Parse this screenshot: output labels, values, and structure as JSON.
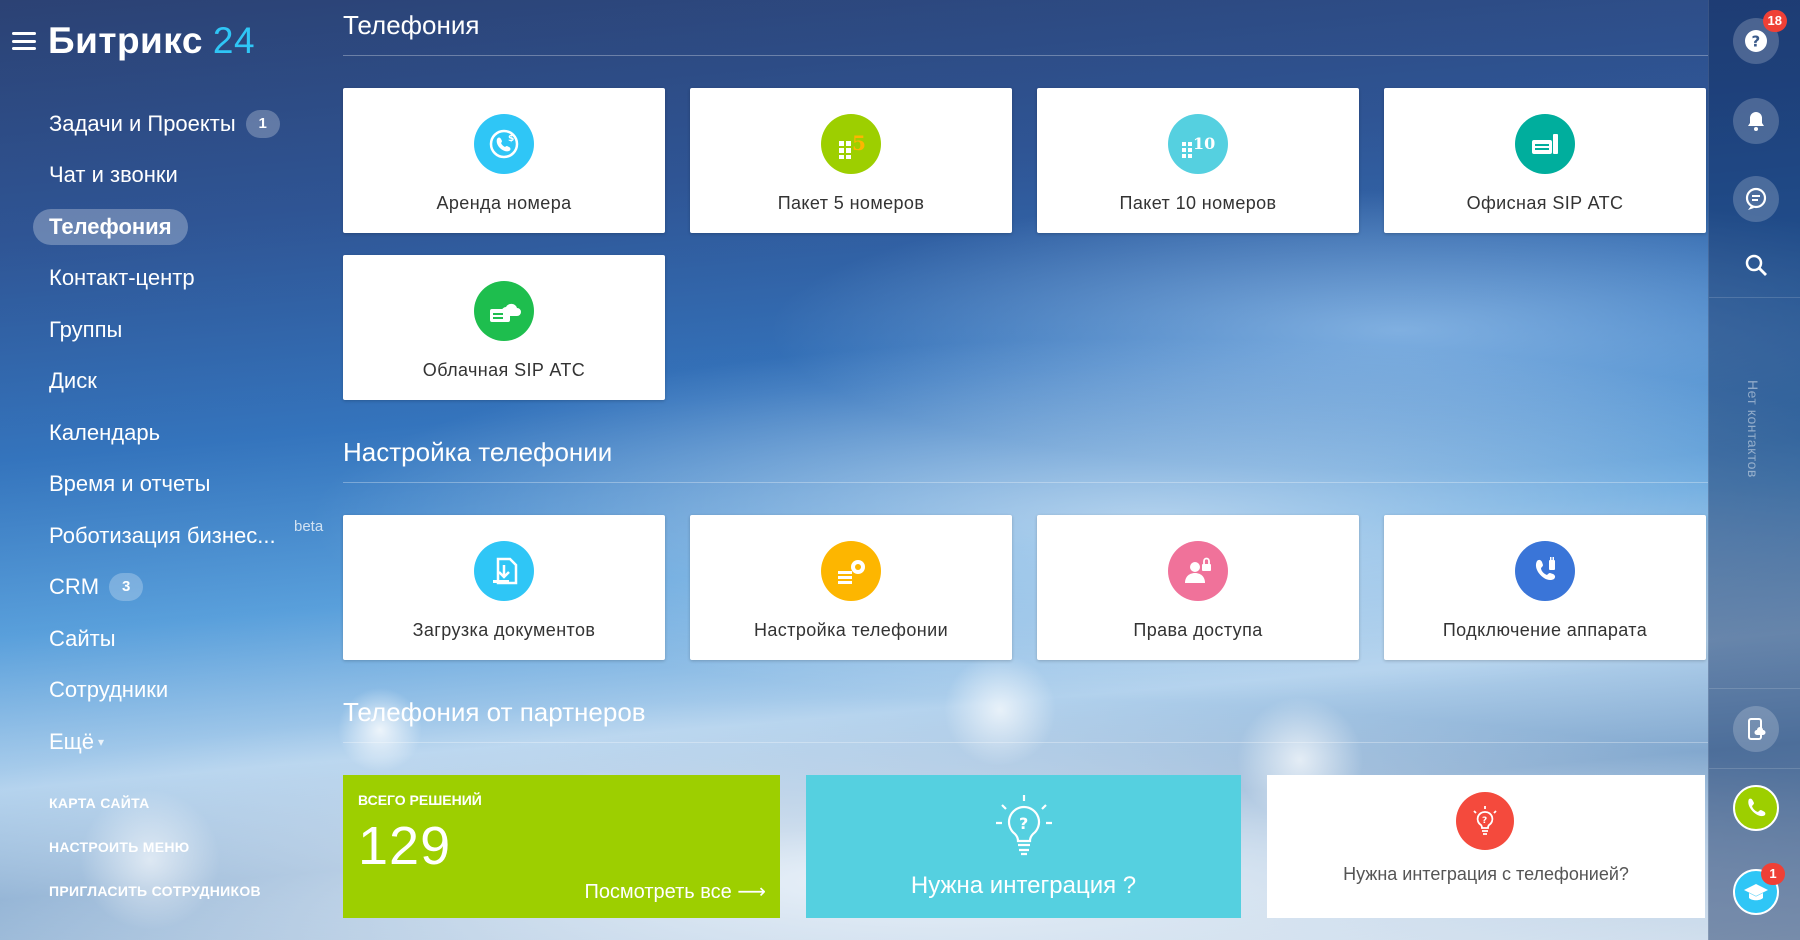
{
  "app": {
    "logo_main": "Битрикс",
    "logo_num": "24"
  },
  "sidebar": {
    "items": [
      {
        "label": "Задачи и Проекты",
        "counter": "1"
      },
      {
        "label": "Чат и звонки"
      },
      {
        "label": "Телефония",
        "active": true
      },
      {
        "label": "Контакт-центр"
      },
      {
        "label": "Группы"
      },
      {
        "label": "Диск"
      },
      {
        "label": "Календарь"
      },
      {
        "label": "Время и отчеты"
      },
      {
        "label": "Роботизация бизнес...",
        "tag": "beta"
      },
      {
        "label": "CRM",
        "counter": "3"
      },
      {
        "label": "Сайты"
      },
      {
        "label": "Сотрудники"
      },
      {
        "label": "Ещё"
      }
    ],
    "footer": [
      "КАРТА САЙТА",
      "НАСТРОИТЬ МЕНЮ",
      "ПРИГЛАСИТЬ СОТРУДНИКОВ"
    ]
  },
  "telephony": {
    "title": "Телефония",
    "tiles": [
      {
        "label": "Аренда номера",
        "icon": "rent-number-icon",
        "color": "#2fc6f6"
      },
      {
        "label": "Пакет 5 номеров",
        "icon": "package-5-icon",
        "color": "#9dcf00"
      },
      {
        "label": "Пакет 10 номеров",
        "icon": "package-10-icon",
        "color": "#55d0e0"
      },
      {
        "label": "Офисная SIP АТС",
        "icon": "office-sip-icon",
        "color": "#00ae9d"
      },
      {
        "label": "Облачная SIP АТС",
        "icon": "cloud-sip-icon",
        "color": "#1ebe4e"
      }
    ]
  },
  "setup": {
    "title": "Настройка телефонии",
    "tiles": [
      {
        "label": "Загрузка документов",
        "icon": "upload-docs-icon",
        "color": "#2fc6f6"
      },
      {
        "label": "Настройка телефонии",
        "icon": "settings-gear-icon",
        "color": "#fdb600"
      },
      {
        "label": "Права доступа",
        "icon": "access-rights-icon",
        "color": "#f0729a"
      },
      {
        "label": "Подключение аппарата",
        "icon": "phone-plug-icon",
        "color": "#3a75d8"
      }
    ]
  },
  "partners": {
    "title": "Телефония от партнеров",
    "total_caption": "ВСЕГО РЕШЕНИЙ",
    "total": "129",
    "see_all": "Посмотреть все  ⟶",
    "need_integration": "Нужна интеграция ?",
    "need_integration_phone": "Нужна интеграция с телефонией?"
  },
  "rightbar": {
    "help_badge": "18",
    "no_contacts": "Нет контактов",
    "academy_badge": "1"
  }
}
